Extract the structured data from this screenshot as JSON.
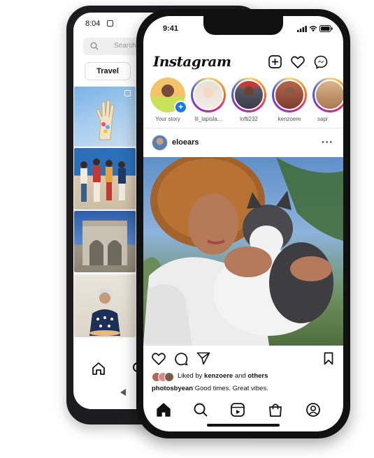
{
  "back_phone": {
    "status_time": "8:04",
    "search_placeholder": "Search",
    "chip_label": "Travel"
  },
  "front_phone": {
    "status_time": "9:41",
    "app_title": "Instagram",
    "stories": [
      {
        "label": "Your story"
      },
      {
        "label": "lil_lapisla..."
      },
      {
        "label": "lofti232"
      },
      {
        "label": "kenzoere"
      },
      {
        "label": "sapi"
      }
    ],
    "post": {
      "username": "eloears",
      "liked_by_prefix": "Liked by ",
      "liked_by_user": "kenzoere",
      "liked_by_suffix": " and ",
      "liked_by_others": "others",
      "caption_user": "photosbyean",
      "caption_text": " Good times. Great vibes."
    }
  },
  "colors": {
    "phone_body": "#111111",
    "instagram_gradient": [
      "#feda75",
      "#fa7e1e",
      "#d62976",
      "#962fbf",
      "#4f5bd5"
    ],
    "add_story_badge": "#1877f2"
  }
}
